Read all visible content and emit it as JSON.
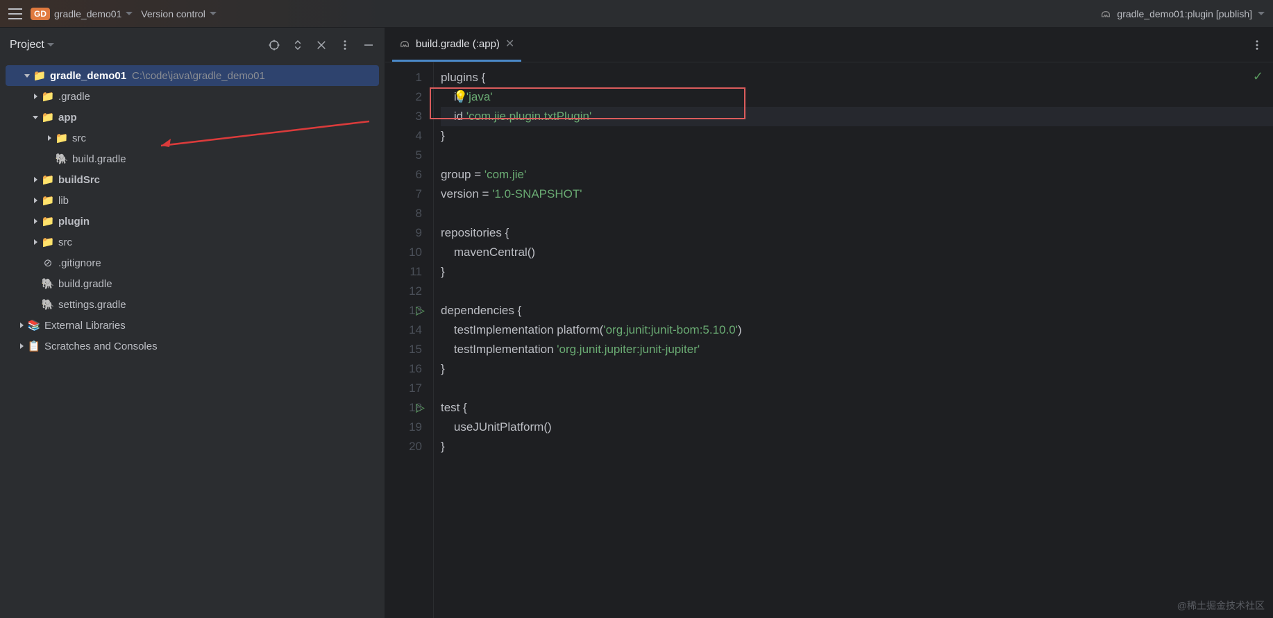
{
  "topbar": {
    "project_abbrev": "GD",
    "project_name": "gradle_demo01",
    "vcs_label": "Version control",
    "run_config_label": "gradle_demo01:plugin [publish]"
  },
  "project_panel": {
    "title": "Project"
  },
  "tree": {
    "root_name": "gradle_demo01",
    "root_path": "C:\\code\\java\\gradle_demo01",
    "gradle_dir": ".gradle",
    "app": "app",
    "app_src": "src",
    "app_build": "build.gradle",
    "buildSrc": "buildSrc",
    "lib": "lib",
    "plugin": "plugin",
    "src": "src",
    "gitignore": ".gitignore",
    "root_build": "build.gradle",
    "settings": "settings.gradle",
    "ext_libs": "External Libraries",
    "scratches": "Scratches and Consoles"
  },
  "tab": {
    "label": "build.gradle (:app)"
  },
  "code": {
    "l1_a": "plugins {",
    "l2_a": "    id ",
    "l2_b": "'java'",
    "l3_a": "    id ",
    "l3_b": "'com.jie.plugin.txtPlugin'",
    "l4_a": "}",
    "l5_a": "",
    "l6_a": "group = ",
    "l6_b": "'com.jie'",
    "l7_a": "version = ",
    "l7_b": "'1.0-SNAPSHOT'",
    "l8_a": "",
    "l9_a": "repositories {",
    "l10_a": "    mavenCentral()",
    "l11_a": "}",
    "l12_a": "",
    "l13_a": "dependencies {",
    "l14_a": "    testImplementation platform(",
    "l14_b": "'org.junit:junit-bom:5.10.0'",
    "l14_c": ")",
    "l15_a": "    testImplementation ",
    "l15_b": "'org.junit.jupiter:junit-jupiter'",
    "l16_a": "}",
    "l17_a": "",
    "l18_a": "test {",
    "l19_a": "    useJUnitPlatform()",
    "l20_a": "}"
  },
  "gutter": {
    "lines": [
      "1",
      "2",
      "3",
      "4",
      "5",
      "6",
      "7",
      "8",
      "9",
      "10",
      "11",
      "12",
      "13",
      "14",
      "15",
      "16",
      "17",
      "18",
      "19",
      "20"
    ]
  },
  "watermark": "@稀土掘金技术社区"
}
